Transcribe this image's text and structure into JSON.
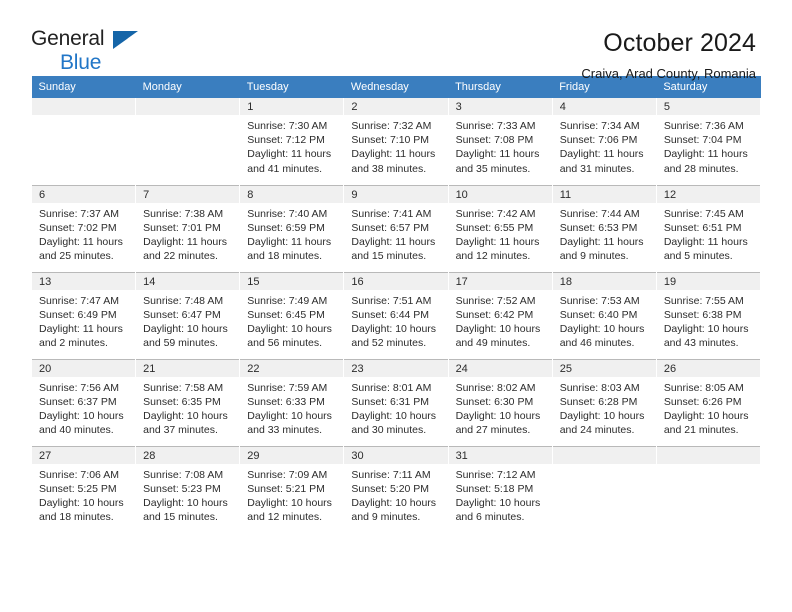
{
  "brand": {
    "name_part1": "General",
    "name_part2": "Blue",
    "accent_color": "#2176c7",
    "triangle_color": "#1565a8"
  },
  "header": {
    "title": "October 2024",
    "subtitle": "Craiva, Arad County, Romania"
  },
  "calendar": {
    "header_bg": "#3a7ebf",
    "weekday_headers": [
      "Sunday",
      "Monday",
      "Tuesday",
      "Wednesday",
      "Thursday",
      "Friday",
      "Saturday"
    ],
    "weeks": [
      {
        "shaded": true,
        "days": [
          {
            "empty": true
          },
          {
            "empty": true
          },
          {
            "day": "1",
            "sunrise": "Sunrise: 7:30 AM",
            "sunset": "Sunset: 7:12 PM",
            "daylight1": "Daylight: 11 hours",
            "daylight2": "and 41 minutes."
          },
          {
            "day": "2",
            "sunrise": "Sunrise: 7:32 AM",
            "sunset": "Sunset: 7:10 PM",
            "daylight1": "Daylight: 11 hours",
            "daylight2": "and 38 minutes."
          },
          {
            "day": "3",
            "sunrise": "Sunrise: 7:33 AM",
            "sunset": "Sunset: 7:08 PM",
            "daylight1": "Daylight: 11 hours",
            "daylight2": "and 35 minutes."
          },
          {
            "day": "4",
            "sunrise": "Sunrise: 7:34 AM",
            "sunset": "Sunset: 7:06 PM",
            "daylight1": "Daylight: 11 hours",
            "daylight2": "and 31 minutes."
          },
          {
            "day": "5",
            "sunrise": "Sunrise: 7:36 AM",
            "sunset": "Sunset: 7:04 PM",
            "daylight1": "Daylight: 11 hours",
            "daylight2": "and 28 minutes."
          }
        ]
      },
      {
        "shaded": true,
        "days": [
          {
            "day": "6",
            "sunrise": "Sunrise: 7:37 AM",
            "sunset": "Sunset: 7:02 PM",
            "daylight1": "Daylight: 11 hours",
            "daylight2": "and 25 minutes."
          },
          {
            "day": "7",
            "sunrise": "Sunrise: 7:38 AM",
            "sunset": "Sunset: 7:01 PM",
            "daylight1": "Daylight: 11 hours",
            "daylight2": "and 22 minutes."
          },
          {
            "day": "8",
            "sunrise": "Sunrise: 7:40 AM",
            "sunset": "Sunset: 6:59 PM",
            "daylight1": "Daylight: 11 hours",
            "daylight2": "and 18 minutes."
          },
          {
            "day": "9",
            "sunrise": "Sunrise: 7:41 AM",
            "sunset": "Sunset: 6:57 PM",
            "daylight1": "Daylight: 11 hours",
            "daylight2": "and 15 minutes."
          },
          {
            "day": "10",
            "sunrise": "Sunrise: 7:42 AM",
            "sunset": "Sunset: 6:55 PM",
            "daylight1": "Daylight: 11 hours",
            "daylight2": "and 12 minutes."
          },
          {
            "day": "11",
            "sunrise": "Sunrise: 7:44 AM",
            "sunset": "Sunset: 6:53 PM",
            "daylight1": "Daylight: 11 hours",
            "daylight2": "and 9 minutes."
          },
          {
            "day": "12",
            "sunrise": "Sunrise: 7:45 AM",
            "sunset": "Sunset: 6:51 PM",
            "daylight1": "Daylight: 11 hours",
            "daylight2": "and 5 minutes."
          }
        ]
      },
      {
        "shaded": true,
        "days": [
          {
            "day": "13",
            "sunrise": "Sunrise: 7:47 AM",
            "sunset": "Sunset: 6:49 PM",
            "daylight1": "Daylight: 11 hours",
            "daylight2": "and 2 minutes."
          },
          {
            "day": "14",
            "sunrise": "Sunrise: 7:48 AM",
            "sunset": "Sunset: 6:47 PM",
            "daylight1": "Daylight: 10 hours",
            "daylight2": "and 59 minutes."
          },
          {
            "day": "15",
            "sunrise": "Sunrise: 7:49 AM",
            "sunset": "Sunset: 6:45 PM",
            "daylight1": "Daylight: 10 hours",
            "daylight2": "and 56 minutes."
          },
          {
            "day": "16",
            "sunrise": "Sunrise: 7:51 AM",
            "sunset": "Sunset: 6:44 PM",
            "daylight1": "Daylight: 10 hours",
            "daylight2": "and 52 minutes."
          },
          {
            "day": "17",
            "sunrise": "Sunrise: 7:52 AM",
            "sunset": "Sunset: 6:42 PM",
            "daylight1": "Daylight: 10 hours",
            "daylight2": "and 49 minutes."
          },
          {
            "day": "18",
            "sunrise": "Sunrise: 7:53 AM",
            "sunset": "Sunset: 6:40 PM",
            "daylight1": "Daylight: 10 hours",
            "daylight2": "and 46 minutes."
          },
          {
            "day": "19",
            "sunrise": "Sunrise: 7:55 AM",
            "sunset": "Sunset: 6:38 PM",
            "daylight1": "Daylight: 10 hours",
            "daylight2": "and 43 minutes."
          }
        ]
      },
      {
        "shaded": true,
        "days": [
          {
            "day": "20",
            "sunrise": "Sunrise: 7:56 AM",
            "sunset": "Sunset: 6:37 PM",
            "daylight1": "Daylight: 10 hours",
            "daylight2": "and 40 minutes."
          },
          {
            "day": "21",
            "sunrise": "Sunrise: 7:58 AM",
            "sunset": "Sunset: 6:35 PM",
            "daylight1": "Daylight: 10 hours",
            "daylight2": "and 37 minutes."
          },
          {
            "day": "22",
            "sunrise": "Sunrise: 7:59 AM",
            "sunset": "Sunset: 6:33 PM",
            "daylight1": "Daylight: 10 hours",
            "daylight2": "and 33 minutes."
          },
          {
            "day": "23",
            "sunrise": "Sunrise: 8:01 AM",
            "sunset": "Sunset: 6:31 PM",
            "daylight1": "Daylight: 10 hours",
            "daylight2": "and 30 minutes."
          },
          {
            "day": "24",
            "sunrise": "Sunrise: 8:02 AM",
            "sunset": "Sunset: 6:30 PM",
            "daylight1": "Daylight: 10 hours",
            "daylight2": "and 27 minutes."
          },
          {
            "day": "25",
            "sunrise": "Sunrise: 8:03 AM",
            "sunset": "Sunset: 6:28 PM",
            "daylight1": "Daylight: 10 hours",
            "daylight2": "and 24 minutes."
          },
          {
            "day": "26",
            "sunrise": "Sunrise: 8:05 AM",
            "sunset": "Sunset: 6:26 PM",
            "daylight1": "Daylight: 10 hours",
            "daylight2": "and 21 minutes."
          }
        ]
      },
      {
        "shaded": true,
        "days": [
          {
            "day": "27",
            "sunrise": "Sunrise: 7:06 AM",
            "sunset": "Sunset: 5:25 PM",
            "daylight1": "Daylight: 10 hours",
            "daylight2": "and 18 minutes."
          },
          {
            "day": "28",
            "sunrise": "Sunrise: 7:08 AM",
            "sunset": "Sunset: 5:23 PM",
            "daylight1": "Daylight: 10 hours",
            "daylight2": "and 15 minutes."
          },
          {
            "day": "29",
            "sunrise": "Sunrise: 7:09 AM",
            "sunset": "Sunset: 5:21 PM",
            "daylight1": "Daylight: 10 hours",
            "daylight2": "and 12 minutes."
          },
          {
            "day": "30",
            "sunrise": "Sunrise: 7:11 AM",
            "sunset": "Sunset: 5:20 PM",
            "daylight1": "Daylight: 10 hours",
            "daylight2": "and 9 minutes."
          },
          {
            "day": "31",
            "sunrise": "Sunrise: 7:12 AM",
            "sunset": "Sunset: 5:18 PM",
            "daylight1": "Daylight: 10 hours",
            "daylight2": "and 6 minutes."
          },
          {
            "empty": true
          },
          {
            "empty": true
          }
        ]
      }
    ]
  }
}
